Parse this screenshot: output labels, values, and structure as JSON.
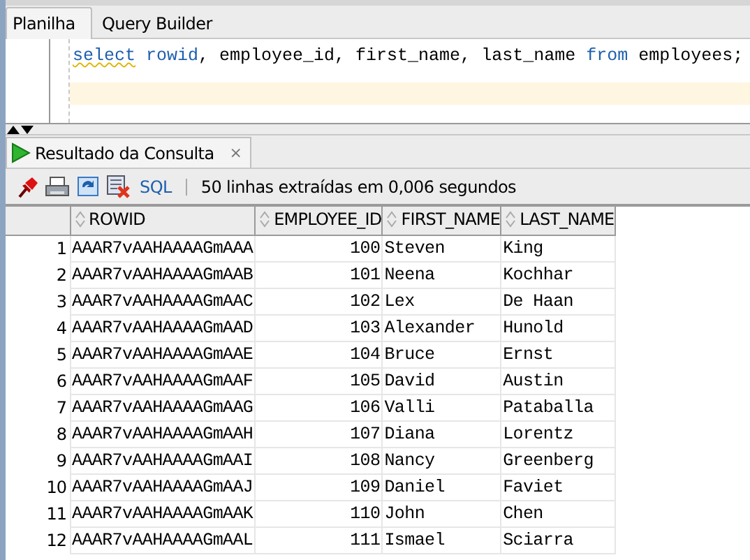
{
  "editor_tabs": [
    {
      "label": "Planilha",
      "selected": true
    },
    {
      "label": "Query Builder",
      "selected": false
    }
  ],
  "sql": [
    {
      "text": "select",
      "kind": "keyword",
      "flagged": true
    },
    {
      "text": " rowid",
      "kind": "keyword",
      "flagged": false
    },
    {
      "text": ", employee_id, first_name, last_name ",
      "kind": "text",
      "flagged": false
    },
    {
      "text": "from",
      "kind": "keyword",
      "flagged": false
    },
    {
      "text": " employees;",
      "kind": "text",
      "flagged": false
    }
  ],
  "result_tab": {
    "label": "Resultado da Consulta",
    "close": "×"
  },
  "toolbar": {
    "sql_link": "SQL",
    "status": "50 linhas extraídas em 0,006 segundos"
  },
  "table": {
    "columns": [
      "",
      "ROWID",
      "EMPLOYEE_ID",
      "FIRST_NAME",
      "LAST_NAME"
    ],
    "rows": [
      [
        "1",
        "AAAR7vAAHAAAAGmAAA",
        "100",
        "Steven",
        "King"
      ],
      [
        "2",
        "AAAR7vAAHAAAAGmAAB",
        "101",
        "Neena",
        "Kochhar"
      ],
      [
        "3",
        "AAAR7vAAHAAAAGmAAC",
        "102",
        "Lex",
        "De Haan"
      ],
      [
        "4",
        "AAAR7vAAHAAAAGmAAD",
        "103",
        "Alexander",
        "Hunold"
      ],
      [
        "5",
        "AAAR7vAAHAAAAGmAAE",
        "104",
        "Bruce",
        "Ernst"
      ],
      [
        "6",
        "AAAR7vAAHAAAAGmAAF",
        "105",
        "David",
        "Austin"
      ],
      [
        "7",
        "AAAR7vAAHAAAAGmAAG",
        "106",
        "Valli",
        "Pataballa"
      ],
      [
        "8",
        "AAAR7vAAHAAAAGmAAH",
        "107",
        "Diana",
        "Lorentz"
      ],
      [
        "9",
        "AAAR7vAAHAAAAGmAAI",
        "108",
        "Nancy",
        "Greenberg"
      ],
      [
        "10",
        "AAAR7vAAHAAAAGmAAJ",
        "109",
        "Daniel",
        "Faviet"
      ],
      [
        "11",
        "AAAR7vAAHAAAAGmAAK",
        "110",
        "John",
        "Chen"
      ],
      [
        "12",
        "AAAR7vAAHAAAAGmAAL",
        "111",
        "Ismael",
        "Sciarra"
      ]
    ]
  }
}
